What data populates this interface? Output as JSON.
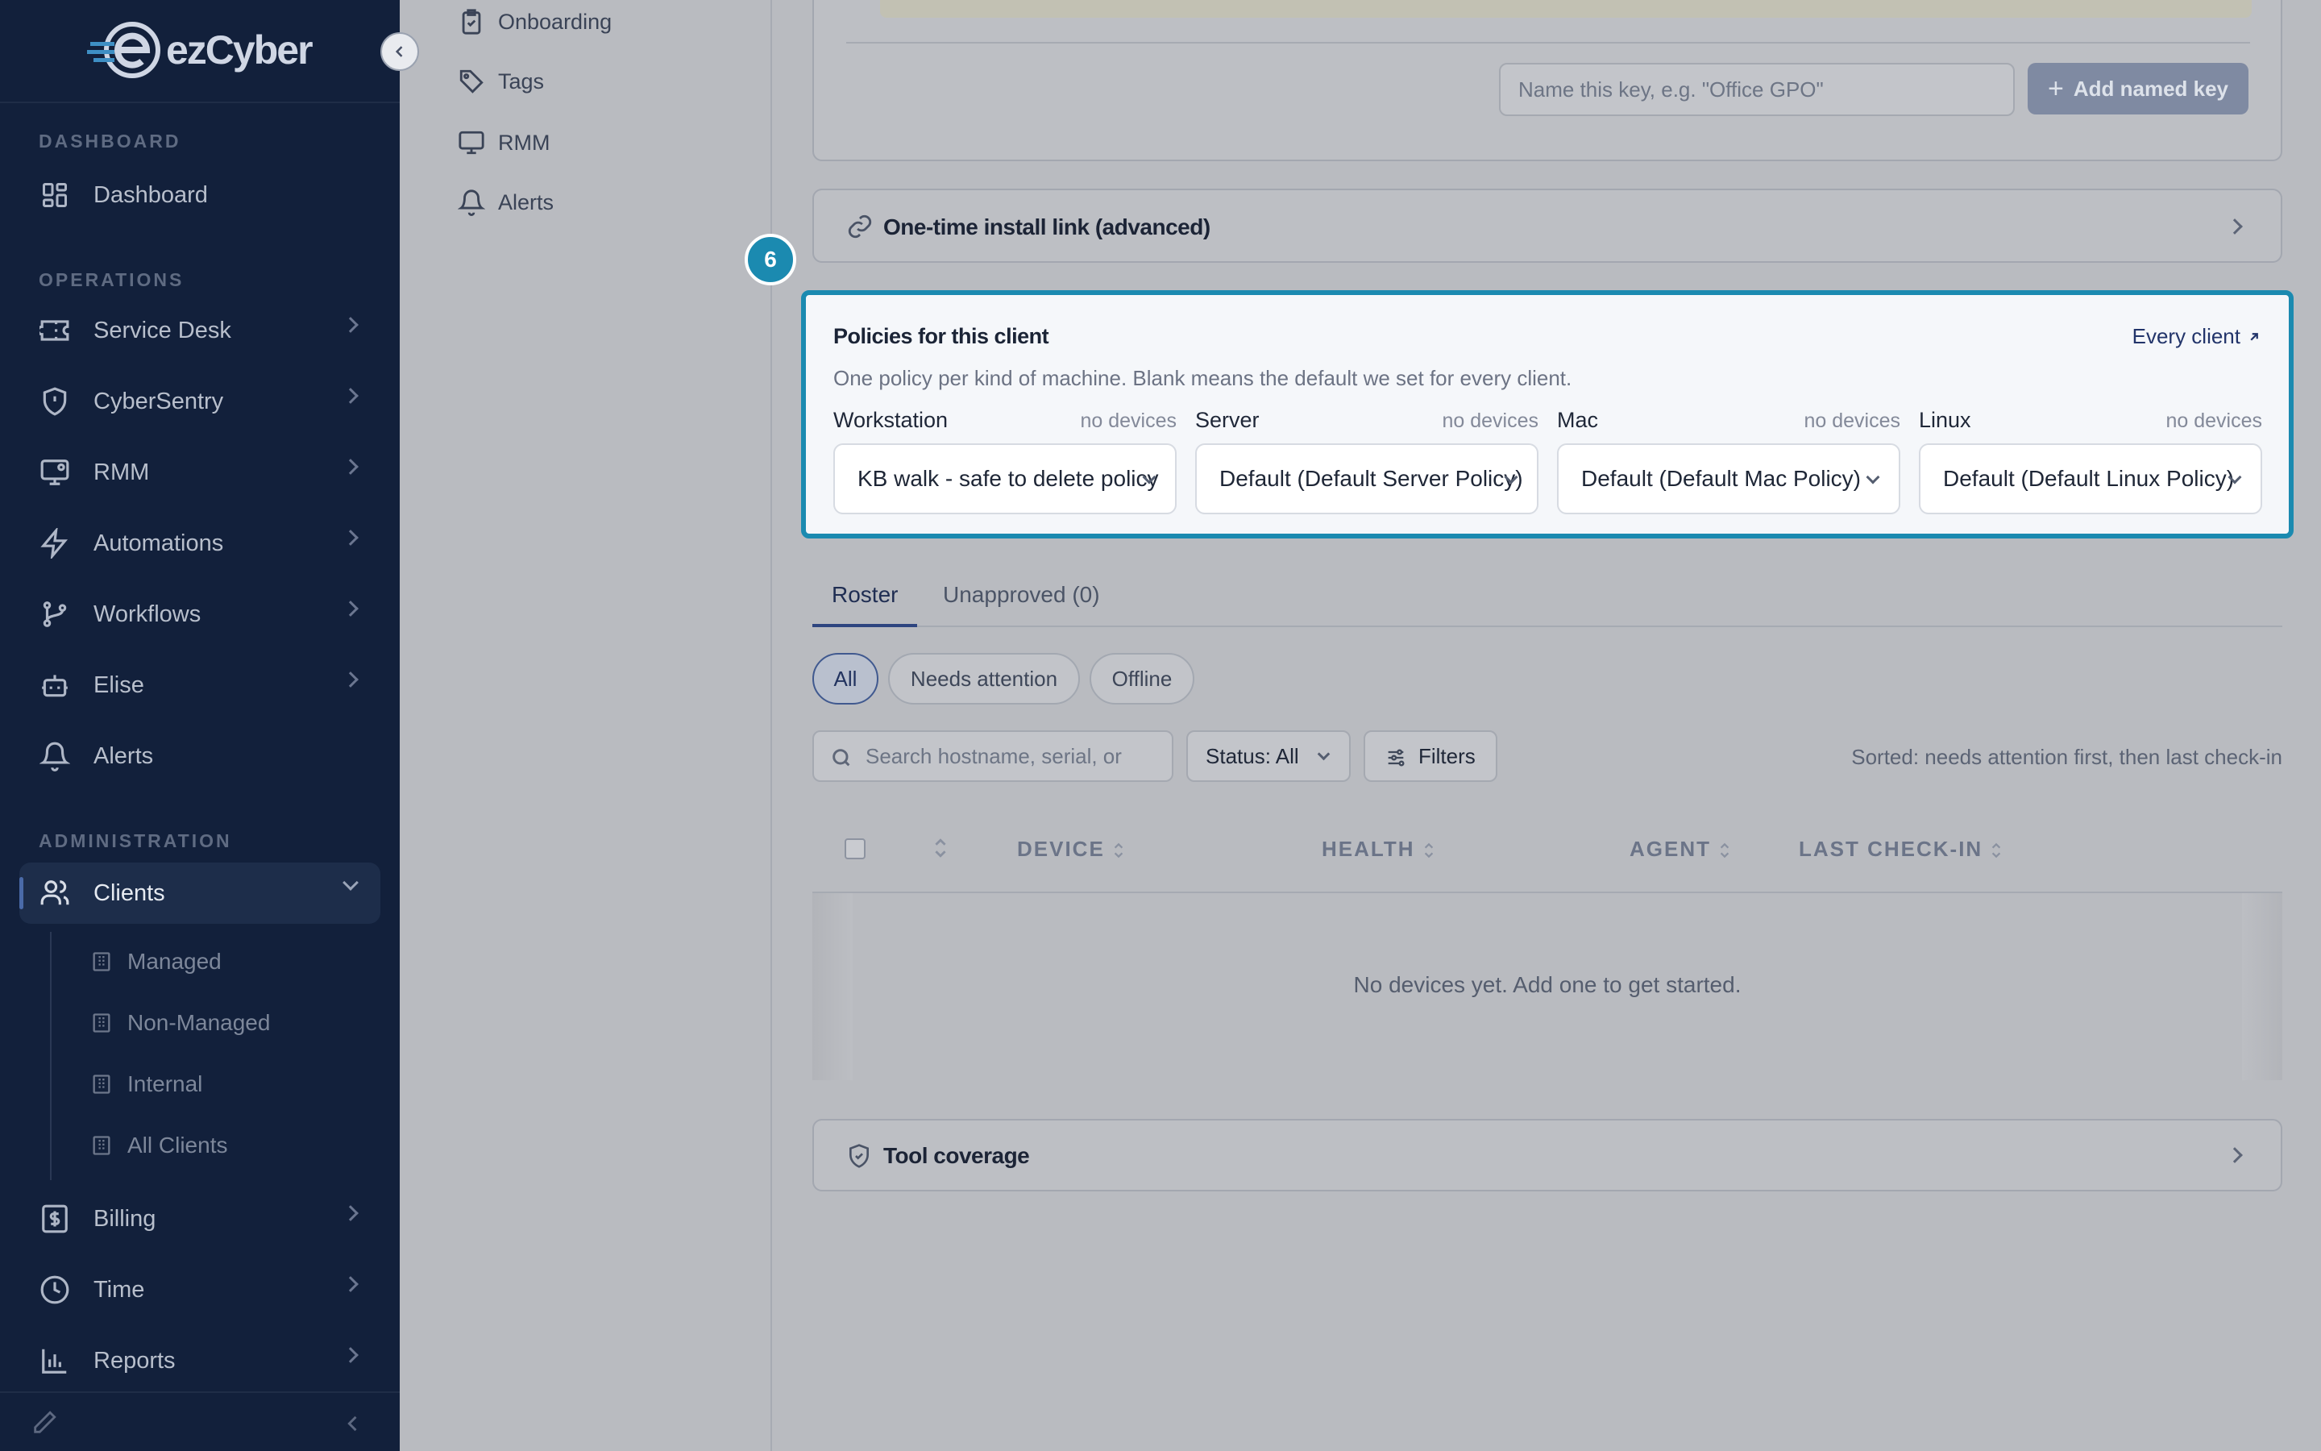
{
  "sidebar": {
    "logo_text": "ezCyber",
    "sections": {
      "dashboard": "DASHBOARD",
      "operations": "OPERATIONS",
      "administration": "ADMINISTRATION"
    },
    "items": [
      {
        "label": "Dashboard",
        "icon": "grid-icon"
      },
      {
        "label": "Service Desk",
        "icon": "ticket-icon"
      },
      {
        "label": "CyberSentry",
        "icon": "shield-icon"
      },
      {
        "label": "RMM",
        "icon": "monitor-icon"
      },
      {
        "label": "Automations",
        "icon": "bolt-icon"
      },
      {
        "label": "Workflows",
        "icon": "branch-icon"
      },
      {
        "label": "Elise",
        "icon": "robot-icon"
      },
      {
        "label": "Alerts",
        "icon": "bell-icon"
      },
      {
        "label": "Clients",
        "icon": "users-icon"
      },
      {
        "label": "Billing",
        "icon": "dollar-icon"
      },
      {
        "label": "Time",
        "icon": "clock-icon"
      },
      {
        "label": "Reports",
        "icon": "bar-chart-icon"
      }
    ],
    "client_sub": [
      "Managed",
      "Non-Managed",
      "Internal",
      "All Clients"
    ]
  },
  "subnav": [
    {
      "label": "Onboarding",
      "icon": "clipboard-icon"
    },
    {
      "label": "Tags",
      "icon": "tag-icon"
    },
    {
      "label": "RMM",
      "icon": "monitor-icon"
    },
    {
      "label": "Alerts",
      "icon": "bell-icon"
    }
  ],
  "keys": {
    "name_placeholder": "Name this key, e.g. \"Office GPO\"",
    "add_named_key": "Add named key"
  },
  "install_link": {
    "title": "One-time install link (advanced)"
  },
  "step_badge": "6",
  "policies": {
    "title": "Policies for this client",
    "every_client": "Every client",
    "description": "One policy per kind of machine. Blank means the default we set for every client.",
    "columns": [
      {
        "label": "Workstation",
        "count": "no devices",
        "value": "KB walk - safe to delete policy"
      },
      {
        "label": "Server",
        "count": "no devices",
        "value": "Default (Default Server Policy)"
      },
      {
        "label": "Mac",
        "count": "no devices",
        "value": "Default (Default Mac Policy)"
      },
      {
        "label": "Linux",
        "count": "no devices",
        "value": "Default (Default Linux Policy)"
      }
    ]
  },
  "tabs": {
    "roster": "Roster",
    "unapproved": "Unapproved (0)"
  },
  "pills": {
    "all": "All",
    "needs_attention": "Needs attention",
    "offline": "Offline"
  },
  "toolbar": {
    "search_placeholder": "Search hostname, serial, or",
    "status": "Status: All",
    "filters": "Filters",
    "sorted": "Sorted: needs attention first, then last check-in"
  },
  "table": {
    "headers": {
      "device": "DEVICE",
      "health": "HEALTH",
      "agent": "AGENT",
      "last_checkin": "LAST CHECK-IN"
    },
    "empty": "No devices yet. Add one to get started."
  },
  "tool_coverage": {
    "title": "Tool coverage"
  }
}
